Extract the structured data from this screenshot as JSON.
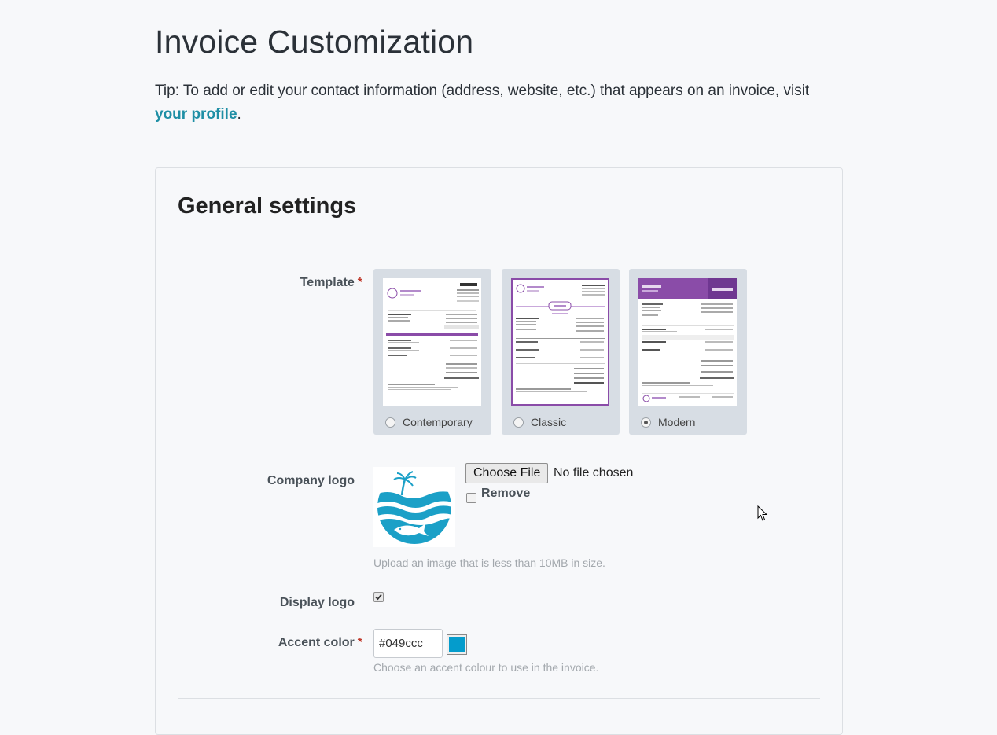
{
  "page": {
    "title": "Invoice Customization",
    "tip_prefix": "Tip: To add or edit your contact information (address, website, etc.) that appears on an invoice, visit",
    "tip_link": "your profile",
    "tip_suffix": "."
  },
  "general": {
    "title": "General settings",
    "template": {
      "label": "Template",
      "required_mark": "*",
      "options": [
        {
          "label": "Contemporary",
          "selected": false
        },
        {
          "label": "Classic",
          "selected": false
        },
        {
          "label": "Modern",
          "selected": true
        }
      ]
    },
    "logo": {
      "label": "Company logo",
      "choose_button": "Choose File",
      "file_status": "No file chosen",
      "remove_label": "Remove",
      "help": "Upload an image that is less than 10MB in size."
    },
    "display_logo": {
      "label": "Display logo",
      "checked": true
    },
    "accent": {
      "label": "Accent color",
      "required_mark": "*",
      "value": "#049ccc",
      "help": "Choose an accent colour to use in the invoice."
    }
  },
  "colors": {
    "link": "#1f8fa5",
    "template_purple": "#8a4ca8",
    "accent": "#049ccc"
  }
}
